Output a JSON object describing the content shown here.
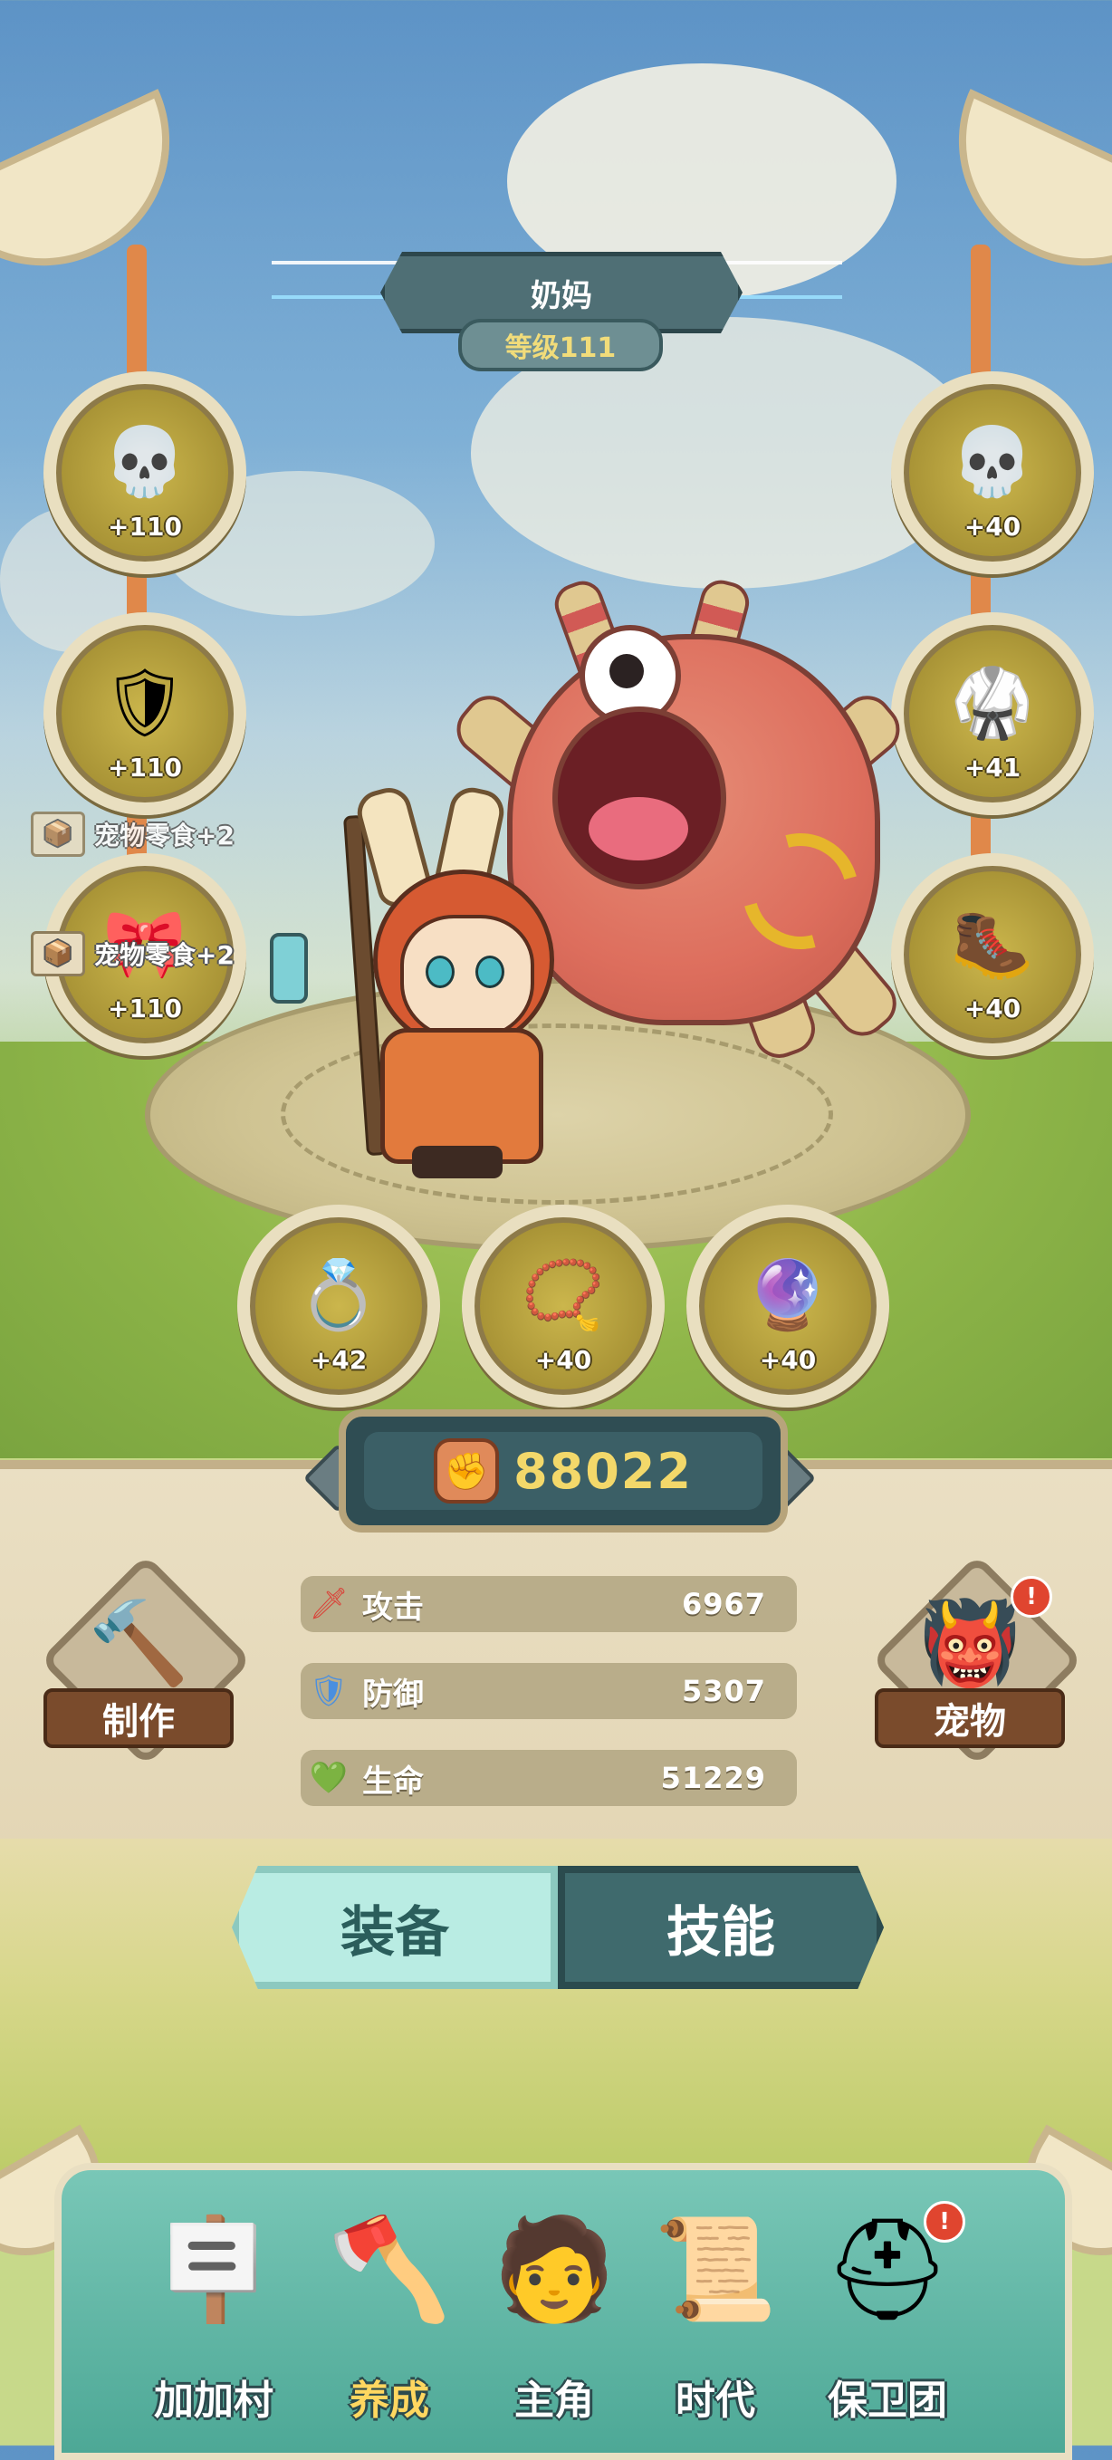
{
  "hero": {
    "name": "奶妈",
    "level_label": "等级111"
  },
  "left_slots": [
    {
      "icon": "spirit-mask-icon",
      "glyph": "💀",
      "value": "+110"
    },
    {
      "icon": "gauntlet-icon",
      "glyph": "🛡",
      "value": "+110"
    },
    {
      "icon": "belt-icon",
      "glyph": "🎀",
      "value": "+110"
    }
  ],
  "right_slots": [
    {
      "icon": "skull-helmet-icon",
      "glyph": "💀",
      "value": "+40"
    },
    {
      "icon": "chest-armor-icon",
      "glyph": "🥋",
      "value": "+41"
    },
    {
      "icon": "boots-icon",
      "glyph": "🥾",
      "value": "+40"
    }
  ],
  "bottom_slots": [
    {
      "icon": "ring-icon",
      "glyph": "💍",
      "value": "+42"
    },
    {
      "icon": "necklace-icon",
      "glyph": "📿",
      "value": "+40"
    },
    {
      "icon": "amulet-icon",
      "glyph": "🔮",
      "value": "+40"
    }
  ],
  "snack_buffs": [
    {
      "label": "宠物零食+2"
    },
    {
      "label": "宠物零食+2"
    }
  ],
  "power": {
    "value": "88022"
  },
  "stats": [
    {
      "name": "攻击",
      "value": "6967",
      "icon": "sword-icon",
      "color": "#d9453b"
    },
    {
      "name": "防御",
      "value": "5307",
      "icon": "shield-icon",
      "color": "#4a8fe0"
    },
    {
      "name": "生命",
      "value": "51229",
      "icon": "heart-icon",
      "color": "#53b94a"
    }
  ],
  "side_buttons": {
    "craft_label": "制作",
    "pet_label": "宠物",
    "pet_alert": "!"
  },
  "tabs": {
    "equipment": "装备",
    "skills": "技能",
    "active": "equipment"
  },
  "nav": [
    {
      "label": "加加村",
      "icon": "signpost-icon",
      "glyph": "🪧"
    },
    {
      "label": "养成",
      "icon": "axe-icon",
      "glyph": "🪓"
    },
    {
      "label": "主角",
      "icon": "hero-face-icon",
      "glyph": "🧑"
    },
    {
      "label": "时代",
      "icon": "map-scroll-icon",
      "glyph": "📜"
    },
    {
      "label": "保卫团",
      "icon": "guard-helmet-icon",
      "glyph": "⛑"
    }
  ],
  "nav_active": "养成",
  "nav_alert": "!",
  "colors": {
    "power_text": "#f3d86a",
    "active_tab": "#b9ece3",
    "inactive_tab": "#3f6a6d",
    "nav_bg": "#4da896"
  }
}
